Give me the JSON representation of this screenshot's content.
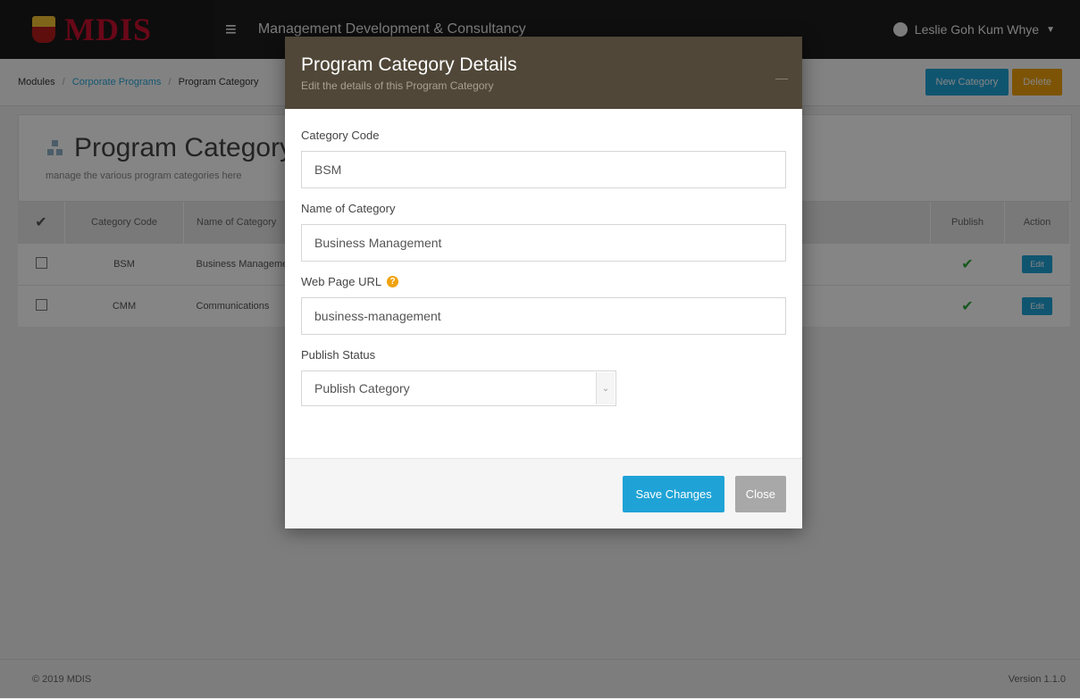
{
  "app": {
    "brand": "MDIS",
    "org_name": "Management Development & Consultancy",
    "user_name": "Leslie Goh Kum Whye"
  },
  "breadcrumb": {
    "items": [
      "Modules",
      "Corporate Programs",
      "Program Category"
    ]
  },
  "toolbar": {
    "new_label": "New Category",
    "delete_label": "Delete"
  },
  "page": {
    "title": "Program Category",
    "subtitle": "manage the various program categories here"
  },
  "table": {
    "headers": [
      "Category Code",
      "Name of Category",
      "Publish",
      "Action"
    ],
    "rows": [
      {
        "code": "BSM",
        "name": "Business Management",
        "action": "Edit"
      },
      {
        "code": "CMM",
        "name": "Communications",
        "action": "Edit"
      }
    ]
  },
  "footer": {
    "copyright": "© 2019 MDIS",
    "version": "Version 1.1.0"
  },
  "modal": {
    "title": "Program Category Details",
    "subtitle": "Edit the details of this Program Category",
    "fields": {
      "code_label": "Category Code",
      "code_value": "BSM",
      "name_label": "Name of Category",
      "name_value": "Business Management",
      "url_label": "Web Page URL",
      "url_value": "business-management",
      "status_label": "Publish Status",
      "status_value": "Publish Category"
    },
    "save_label": "Save Changes",
    "close_label": "Close"
  },
  "colors": {
    "accent": "#1fa3d6",
    "warning": "#f0a20d",
    "modal_header": "#504738",
    "success": "#2eaa3c"
  }
}
